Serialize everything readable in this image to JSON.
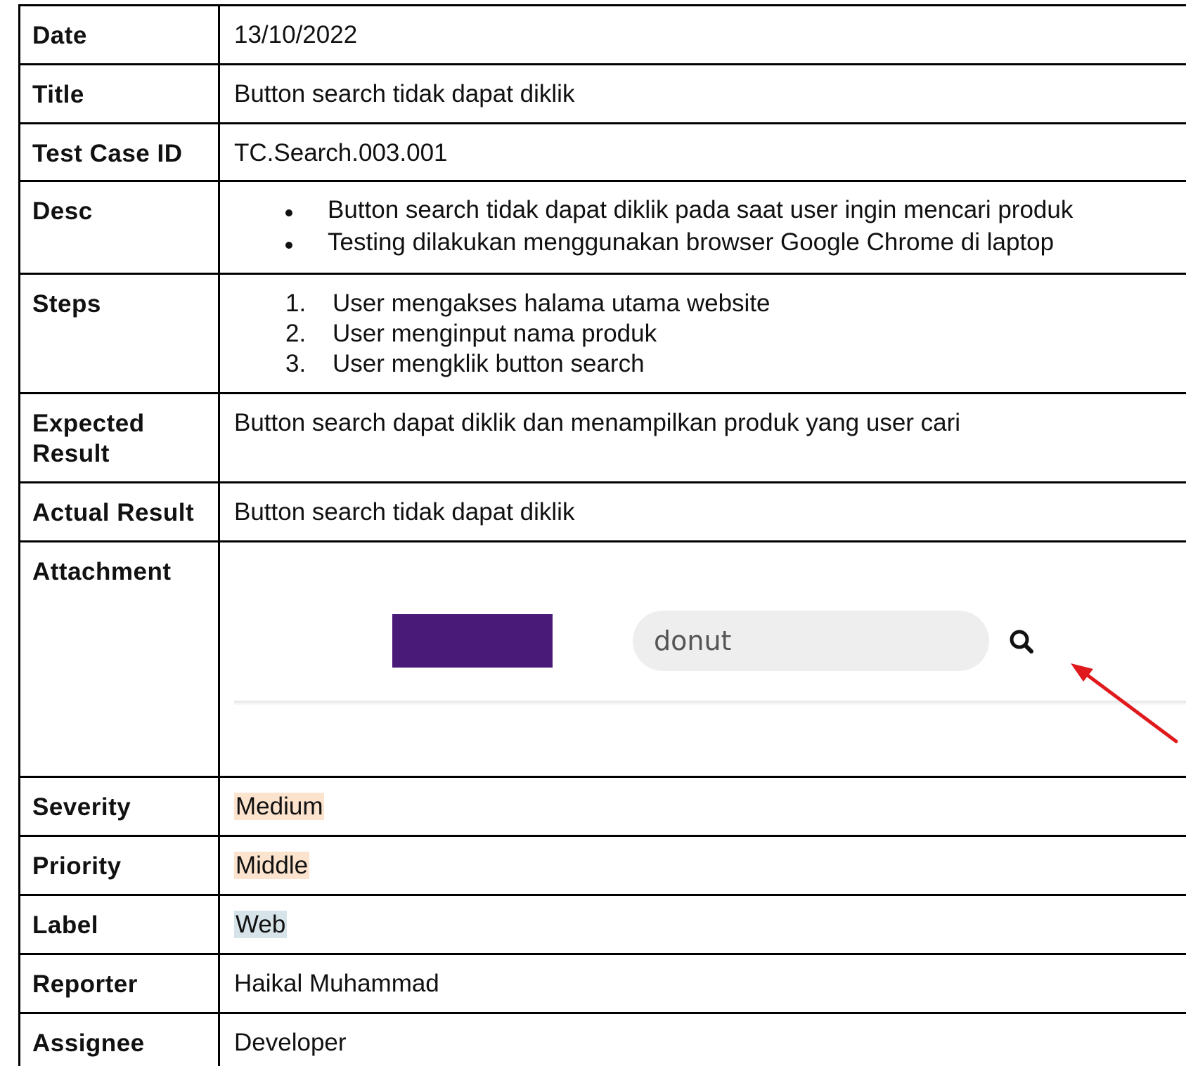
{
  "rows": {
    "date": {
      "label": "Date",
      "value": "13/10/2022"
    },
    "title": {
      "label": "Title",
      "value": "Button search tidak dapat diklik"
    },
    "test_case_id": {
      "label": "Test Case ID",
      "value": "TC.Search.003.001"
    },
    "desc": {
      "label": "Desc",
      "items": [
        "Button search tidak dapat diklik pada saat user ingin mencari produk",
        "Testing dilakukan menggunakan browser Google Chrome di laptop"
      ]
    },
    "steps": {
      "label": "Steps",
      "items": [
        {
          "num": "1.",
          "text": "User mengakses halama utama website"
        },
        {
          "num": "2.",
          "text": "User menginput nama produk"
        },
        {
          "num": "3.",
          "text": "User mengklik button search"
        }
      ]
    },
    "expected": {
      "label_line1": "Expected",
      "label_line2": "Result",
      "value": "Button search dapat diklik dan menampilkan produk yang user cari"
    },
    "actual": {
      "label": "Actual Result",
      "value": "Button search tidak dapat diklik"
    },
    "attachment": {
      "label": "Attachment",
      "search_value": "donut",
      "brand_color": "#4a1a78",
      "arrow_color": "#e0191c",
      "icon": "search-icon"
    },
    "severity": {
      "label": "Severity",
      "value": "Medium",
      "highlight": "#fbe3cd"
    },
    "priority": {
      "label": "Priority",
      "value": "Middle",
      "highlight": "#fbe3cd"
    },
    "label": {
      "label": "Label",
      "value": "Web",
      "highlight": "#d6e4ea"
    },
    "reporter": {
      "label": "Reporter",
      "value": "Haikal Muhammad"
    },
    "assignee": {
      "label": "Assignee",
      "value": "Developer"
    }
  }
}
